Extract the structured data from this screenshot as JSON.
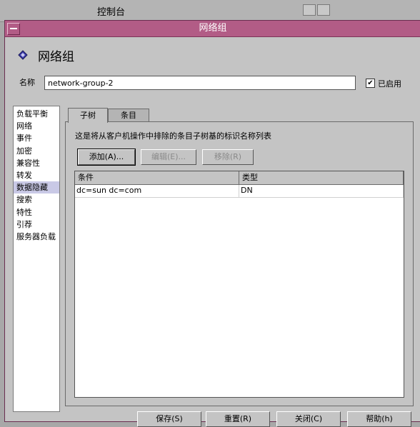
{
  "background_window": {
    "title": "控制台"
  },
  "dialog": {
    "title": "网络组"
  },
  "header": {
    "title": "网络组",
    "icon": "diamond-icon"
  },
  "name_field": {
    "label": "名称",
    "value": "network-group-2"
  },
  "enabled": {
    "label": "已启用",
    "checked": true,
    "mark": "✔"
  },
  "nav": {
    "items": [
      "负载平衡",
      "网络",
      "事件",
      "加密",
      "兼容性",
      "转发",
      "数据隐藏",
      "搜索",
      "特性",
      "引荐",
      "服务器负载"
    ],
    "selected_index": 6
  },
  "tabs": [
    {
      "label": "子树",
      "active": true
    },
    {
      "label": "条目",
      "active": false
    }
  ],
  "panel": {
    "description": "这是将从客户机操作中排除的条目子树基的标识名称列表",
    "buttons": {
      "add": "添加(A)...",
      "edit": "编辑(E)...",
      "remove": "移除(R)"
    },
    "table": {
      "columns": [
        "条件",
        "类型"
      ],
      "rows": [
        {
          "condition": "dc=sun dc=com",
          "type": "DN"
        }
      ]
    }
  },
  "footer": {
    "save": "保存(S)",
    "reset": "重置(R)",
    "close": "关闭(C)",
    "help": "帮助(h)"
  },
  "colors": {
    "titlebar": "#b25c86",
    "dialog_bg": "#c4c4c4",
    "selected_nav": "#c9c9e6"
  }
}
